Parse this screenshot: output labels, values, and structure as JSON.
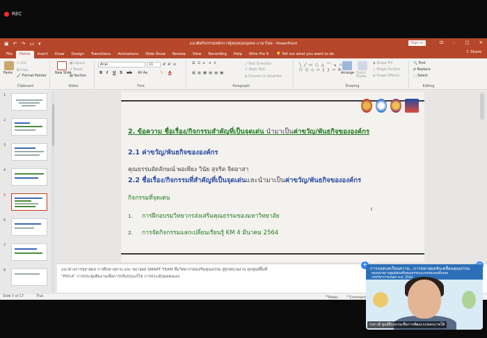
{
  "recording": {
    "label": "REC",
    "color": "#ff2a2a"
  },
  "window": {
    "title": "แนวคิดกิจกรรมหลักการผู้สอนของบุคคล ภาษาไทย - PowerPoint",
    "sign_in": "Sign in",
    "share": "Share",
    "brand_color": "#b7472a"
  },
  "tabs": [
    "File",
    "Home",
    "Insert",
    "Draw",
    "Design",
    "Transitions",
    "Animations",
    "Slide Show",
    "Review",
    "View",
    "Recording",
    "Help",
    "Nitro Pro 9"
  ],
  "active_tab": "Home",
  "tell_me": "Tell me what you want to do",
  "ribbon": {
    "clipboard": {
      "paste": "Paste",
      "cut": "Cut",
      "copy": "Copy",
      "format_painter": "Format Painter",
      "label": "Clipboard"
    },
    "slides": {
      "new_slide": "New Slide",
      "layout": "Layout",
      "reset": "Reset",
      "section": "Section",
      "label": "Slides"
    },
    "font": {
      "name": "Arial",
      "size": "11",
      "label": "Font"
    },
    "paragraph": {
      "text_direction": "Text Direction",
      "align_text": "Align Text",
      "convert_smartart": "Convert to SmartArt",
      "label": "Paragraph"
    },
    "drawing": {
      "arrange": "Arrange",
      "quick_styles": "Quick Styles",
      "shape_fill": "Shape Fill",
      "shape_outline": "Shape Outline",
      "shape_effects": "Shape Effects",
      "label": "Drawing"
    },
    "editing": {
      "find": "Find",
      "replace": "Replace",
      "select": "Select",
      "label": "Editing"
    }
  },
  "thumbnails": [
    "1",
    "2",
    "3",
    "4",
    "5",
    "6",
    "7",
    "8"
  ],
  "selected_slide": "5",
  "slide": {
    "heading_prefix": "2. ข้อความ ชื่อเรื่อง/กิจกรรมสำคัญที่เป็นจุดเด่น",
    "heading_mid": " นำมาเป็น",
    "heading_suffix": "ค่าขวัญ/พันธกิจขององค์กร",
    "sub1": "2.1 ค่าขวัญ/พันธกิจขององค์กร",
    "values_line": "คุณธรรมอัตลักษณ์       พอเพียง วินัย สุจริต จิตอาสา",
    "sub2_prefix": "2.2  ชื่อเรื่อง/กิจกรรมที่สำคัญที่เป็นจุดเด่น",
    "sub2_mid": "และนำมาเป็น",
    "sub2_suffix": "ค่าขวัญ/พันธกิจขององค์กร",
    "highlight_label": "กิจกรรมที่จุดเด่น",
    "items": [
      {
        "num": "1.",
        "text": "การฝึกอบรมวิทยากรส่งเสริมคุณธรรมของมหาวิทยาลัย"
      },
      {
        "num": "2.",
        "text": "การจัดกิจกรรมแลกเปลี่ยนเรียนรู้ KM 4 มีนาคม 2564"
      }
    ]
  },
  "notes": {
    "line1": "แนวทางการขยายผล การฝึกพาสุลาน และ ขยายผล SMART TEAM ที่มวิทยากรส่งเสริมคุณธรรม สู่ทุกหน่วยงาน ทุกศูนย์พื้นที่",
    "line2": "\"PDCA\" การประชุมทีมงานเพื่อการปรับปรุงแก้ไข การประเมินผลตนเอง"
  },
  "status": {
    "slide_of": "Slide 5 of 17",
    "language": "Thai",
    "notes": "Notes",
    "comments": "Comment"
  },
  "webcam": {
    "banner_title": "การถอดบทเรียนความ...การขยายผลขับเคลื่อนคุณธรรม",
    "banner_sub": "ของหน่วยงานศูนย์ส่งเสริมคุณธรรมและพรหมแดนทั้งหมด",
    "banner_sub2": "กรมวิชาการเกษตร พ.ศ. 2564",
    "name_tag": "กนกวดี ศูนย์ฝึกอบรมเพื่อการพัฒนาเกษตรภาคใต้"
  }
}
